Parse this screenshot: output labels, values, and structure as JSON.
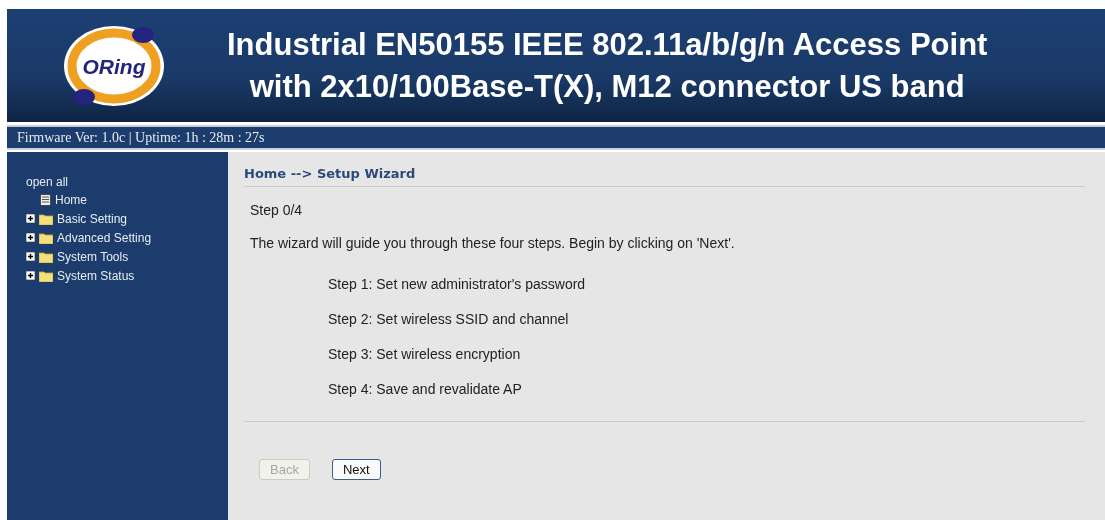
{
  "header": {
    "logo": "ORing",
    "title_lines": [
      "Industrial EN50155 IEEE 802.11a/b/g/n Access Point",
      "with 2x10/100Base-T(X), M12 connector US band"
    ]
  },
  "status_bar": "Firmware Ver: 1.0c | Uptime: 1h : 28m : 27s",
  "sidebar": {
    "open_all": "open all",
    "items": [
      {
        "label": "Home",
        "kind": "page"
      },
      {
        "label": "Basic Setting",
        "kind": "folder",
        "expanded": false
      },
      {
        "label": "Advanced Setting",
        "kind": "folder",
        "expanded": false
      },
      {
        "label": "System Tools",
        "kind": "folder",
        "expanded": false
      },
      {
        "label": "System Status",
        "kind": "folder",
        "expanded": false
      }
    ]
  },
  "breadcrumb": "Home --> Setup Wizard",
  "step": "Step 0/4",
  "intro": "The wizard will guide you through these four steps. Begin by clicking on 'Next'.",
  "steps": [
    "Step 1: Set new administrator's password",
    "Step 2: Set wireless SSID and channel",
    "Step 3: Set wireless encryption",
    "Step 4: Save and revalidate AP"
  ],
  "buttons": [
    {
      "label": "Back",
      "disabled": true
    },
    {
      "label": "Next",
      "disabled": false
    }
  ]
}
